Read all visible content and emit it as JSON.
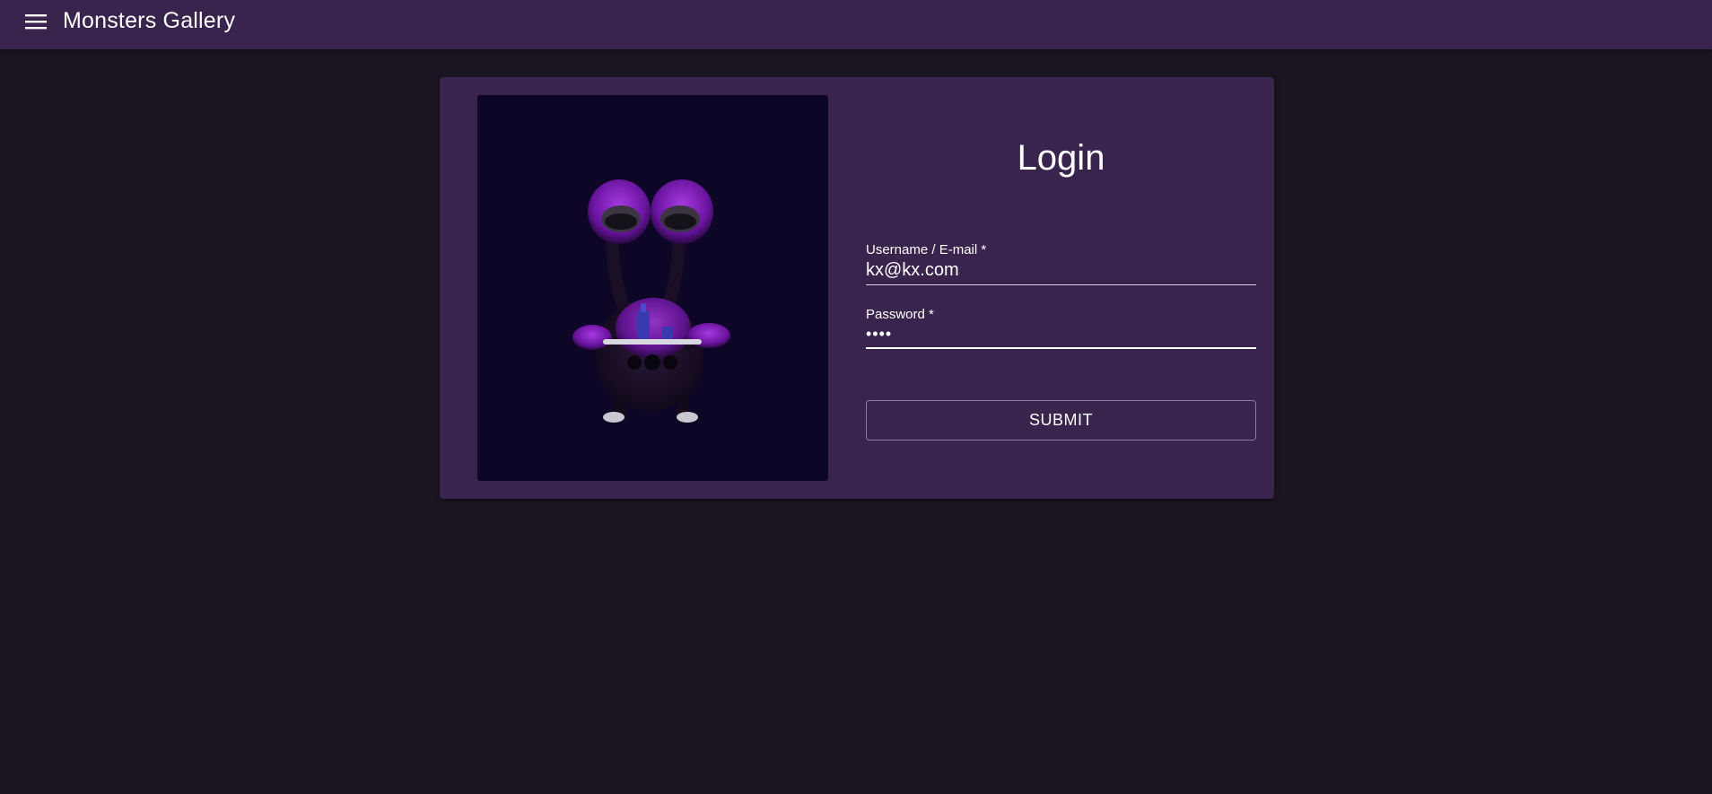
{
  "appbar": {
    "menu_icon": "hamburger-menu-icon",
    "title": "Monsters Gallery"
  },
  "login": {
    "title": "Login",
    "image_subject": "purple-monster-illustration",
    "username": {
      "label": "Username / E-mail *",
      "value": "kx@kx.com"
    },
    "password": {
      "label": "Password *",
      "value": "••••"
    },
    "submit_label": "SUBMIT"
  },
  "colors": {
    "page_background": "#1b1521",
    "appbar_background": "#38244d",
    "card_background": "#38244d",
    "image_background": "#0d0626",
    "monster_fur": "#8a1fbd"
  }
}
